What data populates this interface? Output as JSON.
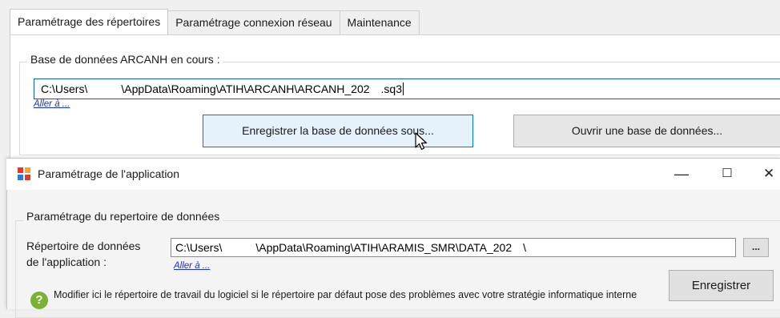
{
  "tabs": [
    {
      "label": "Paramétrage des répertoires",
      "active": true
    },
    {
      "label": "Paramétrage connexion réseau",
      "active": false
    },
    {
      "label": "Maintenance",
      "active": false
    }
  ],
  "database_section": {
    "legend": "Base de données ARCANH en cours :",
    "path_value": "C:\\Users\\   \\AppData\\Roaming\\ATIH\\ARCANH\\ARCANH_202 .sq3",
    "goto_link": "Aller à ...",
    "save_as_button": "Enregistrer la base de données sous...",
    "open_button": "Ouvrir une base de données..."
  },
  "dialog": {
    "title": "Paramétrage de l'application",
    "minimize": "—",
    "maximize": "☐",
    "close": "✕",
    "section_legend": "Paramétrage du repertoire de données",
    "dir_label_line1": "Répertoire de données",
    "dir_label_line2": "de l'application :",
    "dir_value": "C:\\Users\\   \\AppData\\Roaming\\ATIH\\ARAMIS_SMR\\DATA_202 \\",
    "goto_link": "Aller à ...",
    "browse_button": "...",
    "help_text": "Modifier ici le répertoire de travail du logiciel si le répertoire par défaut pose des problèmes avec votre stratégie informatique interne",
    "help_icon": "question-icon",
    "register_button": "Enregistrer"
  },
  "colors": {
    "focus_border": "#0c62b8",
    "link": "#1a2fd0",
    "help_icon": "#7ab334"
  }
}
